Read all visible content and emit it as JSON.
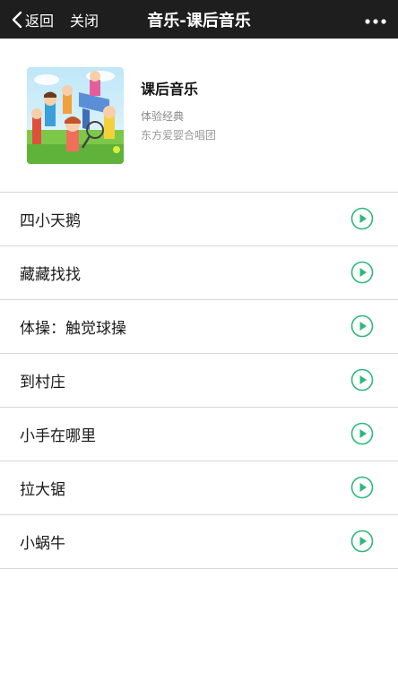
{
  "nav": {
    "back_label": "返回",
    "close_label": "关闭",
    "title": "音乐-课后音乐"
  },
  "album": {
    "title": "课后音乐",
    "subtitle": "体验经典",
    "artist": "东方爱婴合唱团",
    "cover_icon": "kids-playing-illustration"
  },
  "tracks": [
    {
      "name": "四小天鹅"
    },
    {
      "name": "藏藏找找"
    },
    {
      "name": "体操：触觉球操"
    },
    {
      "name": "到村庄"
    },
    {
      "name": "小手在哪里"
    },
    {
      "name": "拉大锯"
    },
    {
      "name": "小蜗牛"
    }
  ],
  "colors": {
    "navbar_bg": "#1e1e1e",
    "play_accent": "#2db87a",
    "divider": "#d8d8d8"
  }
}
